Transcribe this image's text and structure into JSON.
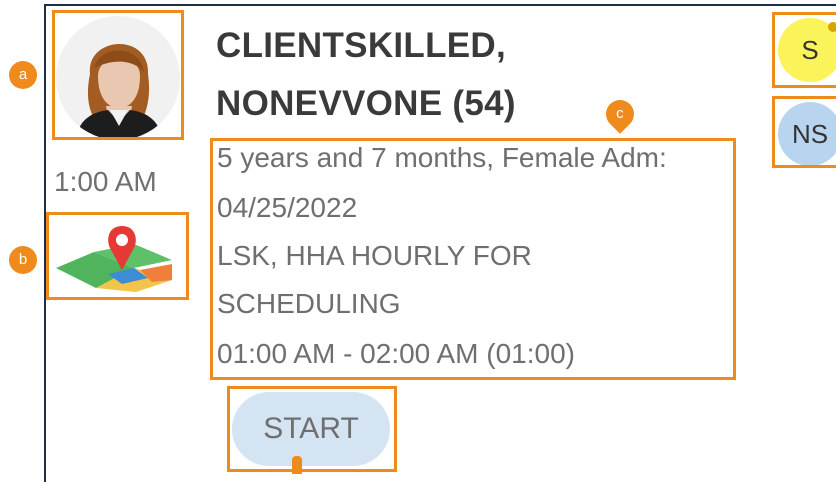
{
  "client": {
    "name_line1": "CLIENTSKILLED,",
    "name_line2": "NONEVVONE (54)"
  },
  "visit": {
    "time": "1:00 AM",
    "details": [
      "5 years and 7 months, Female Adm:",
      "04/25/2022",
      "LSK, HHA HOURLY FOR",
      "SCHEDULING",
      "01:00 AM - 02:00 AM (01:00)"
    ],
    "start_label": "START"
  },
  "status": {
    "s_label": "S",
    "ns_label": "NS"
  },
  "callouts": {
    "a": "a",
    "b": "b",
    "c": "c"
  },
  "colors": {
    "highlight": "#ef8a1c",
    "start_bg": "#d4e4f3",
    "s_bg": "#fbf35a",
    "ns_bg": "#b8d4ee"
  },
  "icons": [
    "avatar-female",
    "map-pin-icon"
  ]
}
